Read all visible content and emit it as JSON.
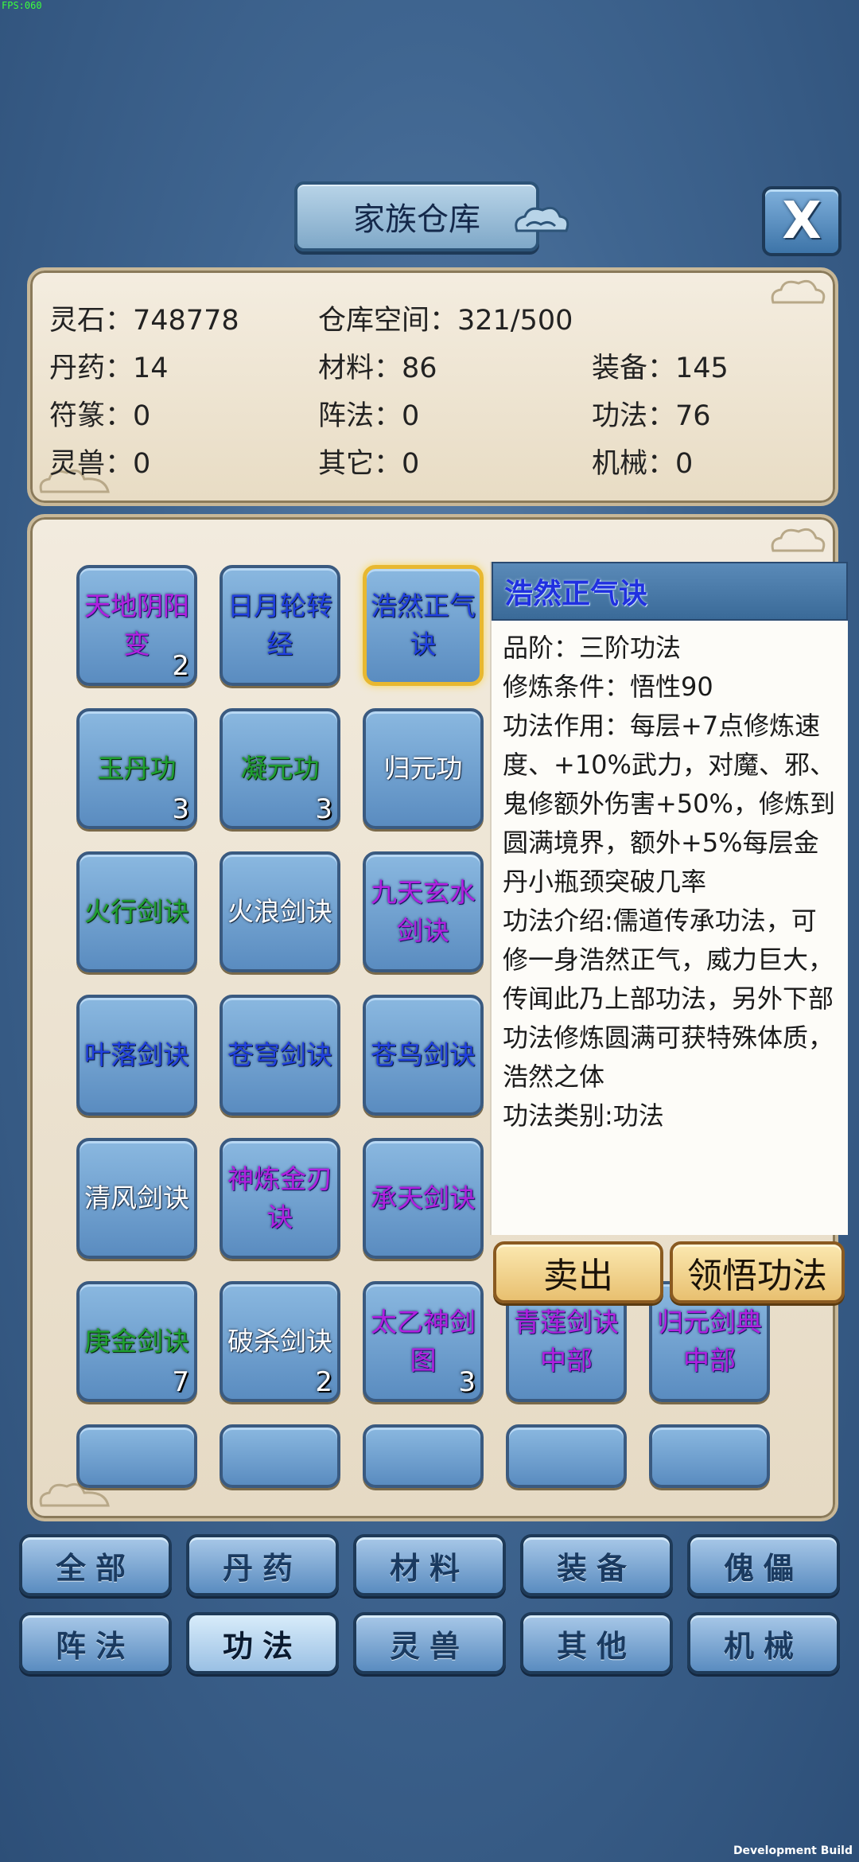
{
  "debug": {
    "fps": "FPS:060",
    "build": "Development Build"
  },
  "title": "家族仓库",
  "close_label": "X",
  "stats": {
    "spirit_stone": "灵石：748778",
    "storage": "仓库空间：321/500",
    "pills": "丹药：14",
    "materials": "材料：86",
    "equipment": "装备：145",
    "talismans": "符篆：0",
    "formations": "阵法：0",
    "techniques": "功法：76",
    "beasts": "灵兽：0",
    "others": "其它：0",
    "machines": "机械：0"
  },
  "items": [
    {
      "name": "天地阴阳变",
      "count": "2",
      "quality": "purple"
    },
    {
      "name": "日月轮转经",
      "count": "",
      "quality": "blue"
    },
    {
      "name": "浩然正气诀",
      "count": "",
      "quality": "blue"
    },
    {
      "name": "玉丹功",
      "count": "3",
      "quality": "green"
    },
    {
      "name": "凝元功",
      "count": "3",
      "quality": "green"
    },
    {
      "name": "归元功",
      "count": "",
      "quality": "white"
    },
    {
      "name": "火行剑诀",
      "count": "",
      "quality": "green"
    },
    {
      "name": "火浪剑诀",
      "count": "",
      "quality": "white"
    },
    {
      "name": "九天玄水剑诀",
      "count": "",
      "quality": "purple"
    },
    {
      "name": "叶落剑诀",
      "count": "",
      "quality": "blue"
    },
    {
      "name": "苍穹剑诀",
      "count": "",
      "quality": "blue"
    },
    {
      "name": "苍鸟剑诀",
      "count": "",
      "quality": "blue"
    },
    {
      "name": "清风剑诀",
      "count": "",
      "quality": "white"
    },
    {
      "name": "神炼金刃诀",
      "count": "",
      "quality": "purple"
    },
    {
      "name": "承天剑诀",
      "count": "",
      "quality": "purple"
    },
    {
      "name": "庚金剑诀",
      "count": "7",
      "quality": "green"
    },
    {
      "name": "破杀剑诀",
      "count": "2",
      "quality": "white"
    },
    {
      "name": "太乙神剑图",
      "count": "3",
      "quality": "purple"
    },
    {
      "name": "青莲剑诀中部",
      "count": "",
      "quality": "purple"
    },
    {
      "name": "归元剑典中部",
      "count": "",
      "quality": "purple"
    }
  ],
  "tooltip": {
    "name": "浩然正气诀",
    "rank": "品阶：三阶功法",
    "requirement": "修炼条件：悟性90",
    "effect": "功法作用：每层+7点修炼速度、+10%武力，对魔、邪、鬼修额外伤害+50%，修炼到圆满境界，额外+5%每层金丹小瓶颈突破几率",
    "intro": "功法介绍:儒道传承功法，可修一身浩然正气，威力巨大，传闻此乃上部功法，另外下部功法修炼圆满可获特殊体质，浩然之体",
    "category": "功法类别:功法"
  },
  "actions": {
    "sell": "卖出",
    "comprehend": "领悟功法"
  },
  "tabs": [
    {
      "label": "全部"
    },
    {
      "label": "丹药"
    },
    {
      "label": "材料"
    },
    {
      "label": "装备"
    },
    {
      "label": "傀儡"
    },
    {
      "label": "阵法"
    },
    {
      "label": "功法"
    },
    {
      "label": "灵兽"
    },
    {
      "label": "其他"
    },
    {
      "label": "机械"
    }
  ],
  "active_tab": "功法",
  "colors": {
    "purple": "#b020e0",
    "green": "#1fa030",
    "blue": "#2040e0",
    "white": "#ffffff"
  }
}
